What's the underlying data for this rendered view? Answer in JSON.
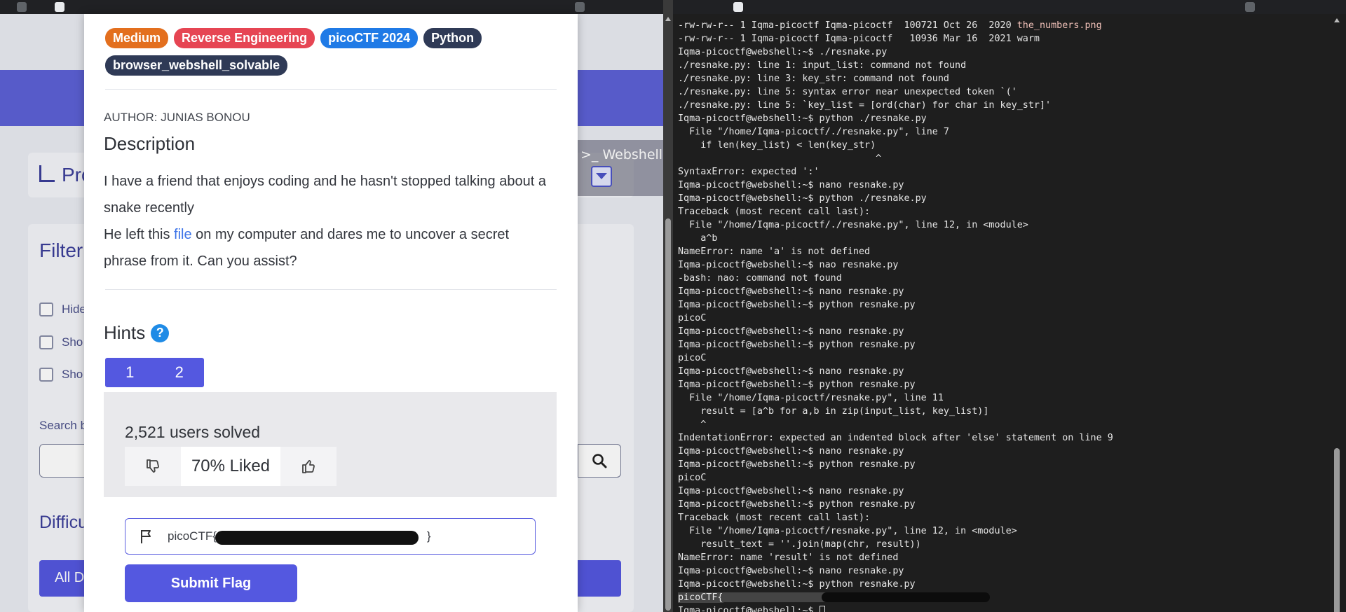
{
  "left_page": {
    "bg_title_partial": "Pro",
    "bg_filter_partial": "Filter",
    "bg_checks": [
      "Hide",
      "Sho",
      "Sho"
    ],
    "bg_search_label": "Search b",
    "bg_difficulty": "Difficu",
    "bg_all_label": "All D",
    "webshell_label": ">_ Webshell"
  },
  "modal": {
    "tags": [
      {
        "label": "Medium",
        "color": "#e36f1e"
      },
      {
        "label": "Reverse Engineering",
        "color": "#e64553"
      },
      {
        "label": "picoCTF 2024",
        "color": "#1f7ae6"
      },
      {
        "label": "Python",
        "color": "#2f3a56"
      },
      {
        "label": "browser_webshell_solvable",
        "color": "#2f3a56"
      }
    ],
    "author": "AUTHOR: JUNIAS BONOU",
    "description_title": "Description",
    "desc_part1": "I have a friend that enjoys coding and he hasn't stopped talking about a snake recently",
    "desc_part2_pre": "He left this ",
    "desc_link": "file",
    "desc_part2_post": " on my computer and dares me to uncover a secret phrase from it. Can you assist?",
    "hints_title": "Hints",
    "hint_tabs": [
      "1",
      "2"
    ],
    "solved_text": "2,521 users solved",
    "liked_text": "70% Liked",
    "flag_value_visible": "picoCTF{",
    "flag_value_tail": "}",
    "submit_label": "Submit Flag"
  },
  "terminal": {
    "lines": [
      {
        "pre": "-rw-rw-r-- 1 Iqma-picoctf Iqma-picoctf  100721 Oct 26  2020 ",
        "file": "the_numbers.png"
      },
      {
        "text": "-rw-rw-r-- 1 Iqma-picoctf Iqma-picoctf   10936 Mar 16  2021 warm"
      },
      {
        "text": "Iqma-picoctf@webshell:~$ ./resnake.py"
      },
      {
        "text": "./resnake.py: line 1: input_list: command not found"
      },
      {
        "text": "./resnake.py: line 3: key_str: command not found"
      },
      {
        "text": "./resnake.py: line 5: syntax error near unexpected token `('"
      },
      {
        "text": "./resnake.py: line 5: `key_list = [ord(char) for char in key_str]'"
      },
      {
        "text": "Iqma-picoctf@webshell:~$ python ./resnake.py"
      },
      {
        "text": "  File \"/home/Iqma-picoctf/./resnake.py\", line 7"
      },
      {
        "text": "    if len(key_list) < len(key_str)"
      },
      {
        "text": "                                   ^"
      },
      {
        "text": "SyntaxError: expected ':'"
      },
      {
        "text": "Iqma-picoctf@webshell:~$ nano resnake.py"
      },
      {
        "text": "Iqma-picoctf@webshell:~$ python ./resnake.py"
      },
      {
        "text": "Traceback (most recent call last):"
      },
      {
        "text": "  File \"/home/Iqma-picoctf/./resnake.py\", line 12, in <module>"
      },
      {
        "text": "    a^b"
      },
      {
        "text": "NameError: name 'a' is not defined"
      },
      {
        "text": "Iqma-picoctf@webshell:~$ nao resnake.py"
      },
      {
        "text": "-bash: nao: command not found"
      },
      {
        "text": "Iqma-picoctf@webshell:~$ nano resnake.py"
      },
      {
        "text": "Iqma-picoctf@webshell:~$ python resnake.py"
      },
      {
        "text": "picoC"
      },
      {
        "text": "Iqma-picoctf@webshell:~$ nano resnake.py"
      },
      {
        "text": "Iqma-picoctf@webshell:~$ python resnake.py"
      },
      {
        "text": "picoC"
      },
      {
        "text": "Iqma-picoctf@webshell:~$ nano resnake.py"
      },
      {
        "text": "Iqma-picoctf@webshell:~$ python resnake.py"
      },
      {
        "text": "  File \"/home/Iqma-picoctf/resnake.py\", line 11"
      },
      {
        "text": "    result = [a^b for a,b in zip(input_list, key_list)]"
      },
      {
        "text": "    ^"
      },
      {
        "text": "IndentationError: expected an indented block after 'else' statement on line 9"
      },
      {
        "text": "Iqma-picoctf@webshell:~$ nano resnake.py"
      },
      {
        "text": "Iqma-picoctf@webshell:~$ python resnake.py"
      },
      {
        "text": "picoC"
      },
      {
        "text": "Iqma-picoctf@webshell:~$ nano resnake.py"
      },
      {
        "text": "Iqma-picoctf@webshell:~$ python resnake.py"
      },
      {
        "text": "Traceback (most recent call last):"
      },
      {
        "text": "  File \"/home/Iqma-picoctf/resnake.py\", line 12, in <module>"
      },
      {
        "text": "    result_text = ''.join(map(chr, result))"
      },
      {
        "text": "NameError: name 'result' is not defined"
      },
      {
        "text": "Iqma-picoctf@webshell:~$ nano resnake.py"
      },
      {
        "text": "Iqma-picoctf@webshell:~$ python resnake.py"
      },
      {
        "redacted": "picoCTF{"
      },
      {
        "prompt": "Iqma-picoctf@webshell:~$ "
      }
    ]
  }
}
